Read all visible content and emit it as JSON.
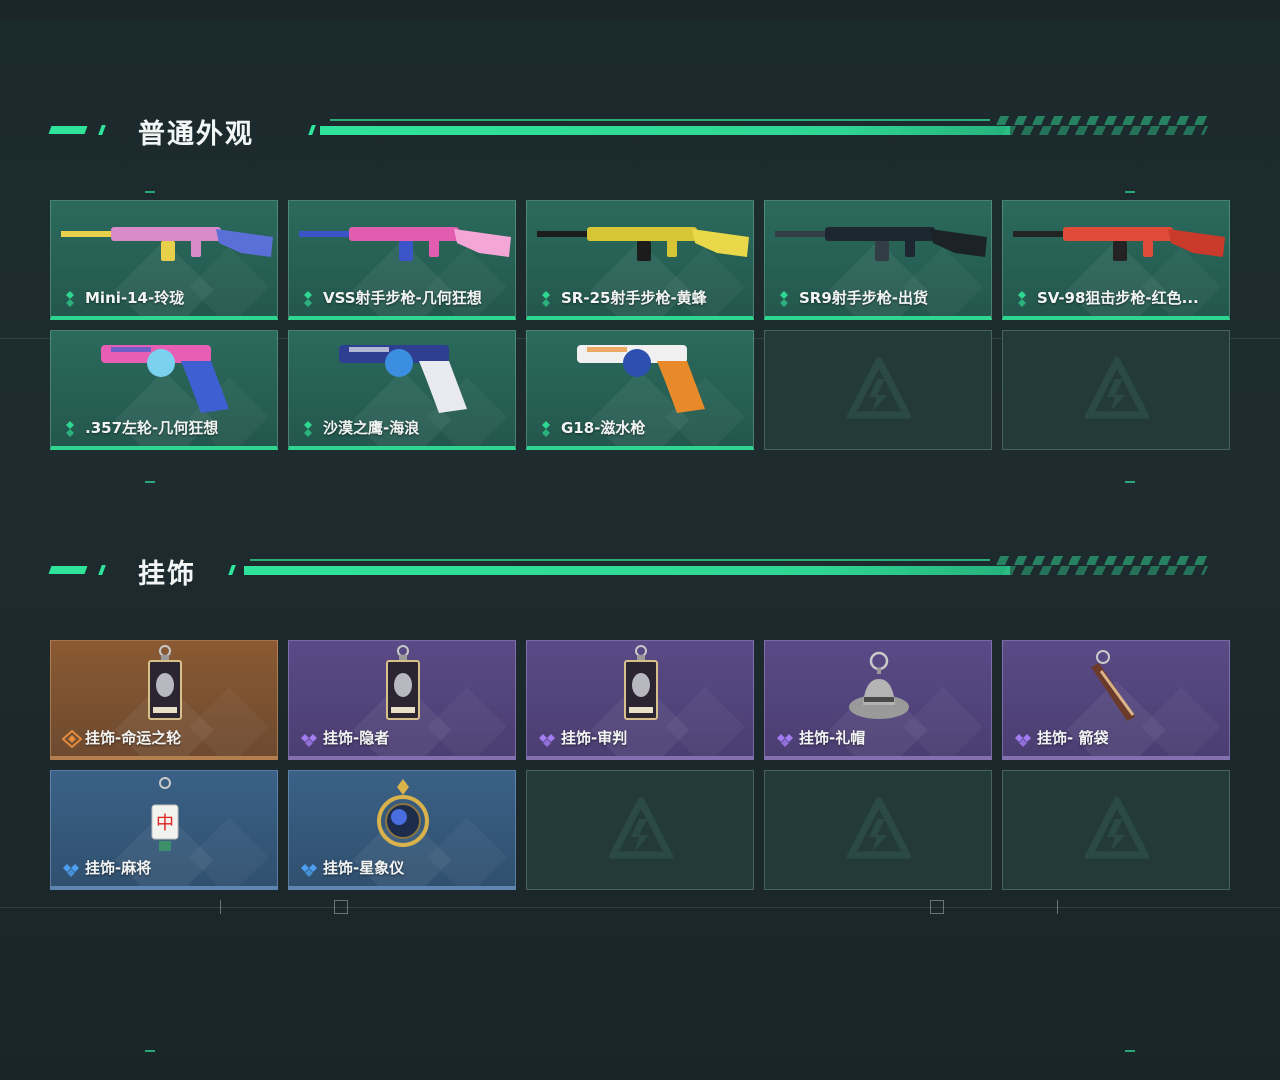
{
  "sections": {
    "skins": {
      "title": "普通外观",
      "items": [
        {
          "name": "Mini-14-玲珑",
          "rarity": "green",
          "icon": "rifle-icon"
        },
        {
          "name": "VSS射手步枪-几何狂想",
          "rarity": "green",
          "icon": "rifle-icon"
        },
        {
          "name": "SR-25射手步枪-黄蜂",
          "rarity": "green",
          "icon": "rifle-icon"
        },
        {
          "name": "SR9射手步枪-出货",
          "rarity": "green",
          "icon": "rifle-icon"
        },
        {
          "name": "SV-98狙击步枪-红色...",
          "rarity": "green",
          "icon": "sniper-icon"
        },
        {
          "name": ".357左轮-几何狂想",
          "rarity": "green",
          "icon": "revolver-icon"
        },
        {
          "name": "沙漠之鹰-海浪",
          "rarity": "green",
          "icon": "pistol-icon"
        },
        {
          "name": "G18-滋水枪",
          "rarity": "green",
          "icon": "pistol-icon"
        }
      ]
    },
    "charms": {
      "title": "挂饰",
      "items": [
        {
          "name": "挂饰-命运之轮",
          "rarity": "gold",
          "icon": "tarot-card-charm-icon"
        },
        {
          "name": "挂饰-隐者",
          "rarity": "purple",
          "icon": "tarot-card-charm-icon"
        },
        {
          "name": "挂饰-审判",
          "rarity": "purple",
          "icon": "tarot-card-charm-icon"
        },
        {
          "name": "挂饰-礼帽",
          "rarity": "purple",
          "icon": "hat-charm-icon"
        },
        {
          "name": "挂饰- 箭袋",
          "rarity": "purple",
          "icon": "quiver-charm-icon"
        },
        {
          "name": "挂饰-麻将",
          "rarity": "blue",
          "icon": "mahjong-charm-icon"
        },
        {
          "name": "挂饰-星象仪",
          "rarity": "blue",
          "icon": "astrolabe-charm-icon"
        }
      ]
    }
  },
  "colors": {
    "accent": "#2fe49a",
    "green": "#2fd690",
    "gold": "#e28a3d",
    "purple": "#a27cf0",
    "blue": "#4da0f0"
  }
}
